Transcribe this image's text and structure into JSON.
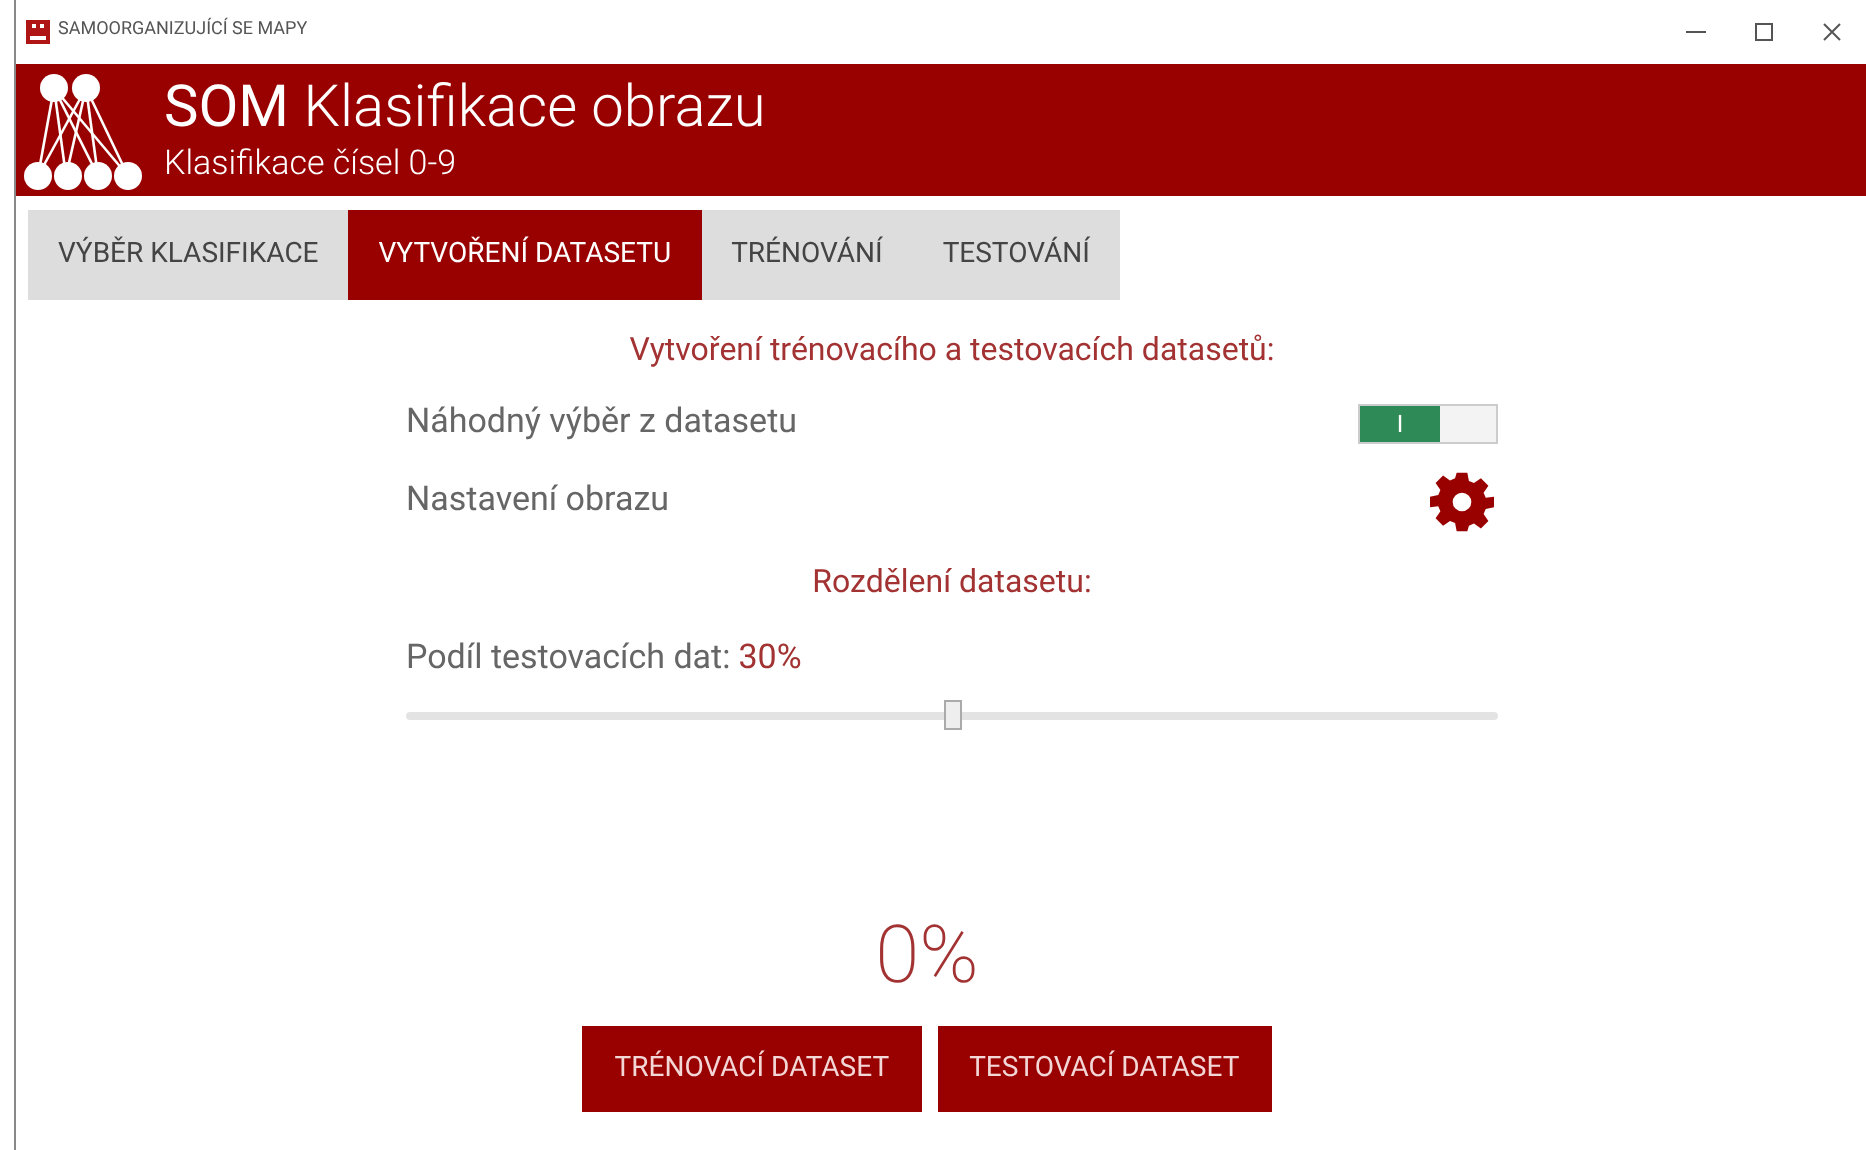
{
  "window": {
    "title": "SAMOORGANIZUJÍCÍ SE MAPY"
  },
  "header": {
    "title_bold": "SOM",
    "title_rest": "Klasifikace obrazu",
    "subtitle": "Klasifikace čísel 0-9"
  },
  "tabs": [
    {
      "label": "VÝBĚR KLASIFIKACE",
      "selected": false
    },
    {
      "label": "VYTVOŘENÍ DATASETU",
      "selected": true
    },
    {
      "label": "TRÉNOVÁNÍ",
      "selected": false
    },
    {
      "label": "TESTOVÁNÍ",
      "selected": false
    }
  ],
  "section_title": "Vytvoření trénovacího a testovacích datasetů:",
  "random_selection": {
    "label": "Náhodný výběr z datasetu",
    "on": true,
    "on_text": "I"
  },
  "image_settings": {
    "label": "Nastavení obrazu"
  },
  "split_title": "Rozdělení datasetu:",
  "test_share": {
    "label": "Podíl testovacích dat:",
    "value": "30%",
    "level": 0.5
  },
  "progress": "0%",
  "buttons": [
    "TRÉNOVACÍ DATASET",
    "TESTOVACÍ DATASET"
  ]
}
